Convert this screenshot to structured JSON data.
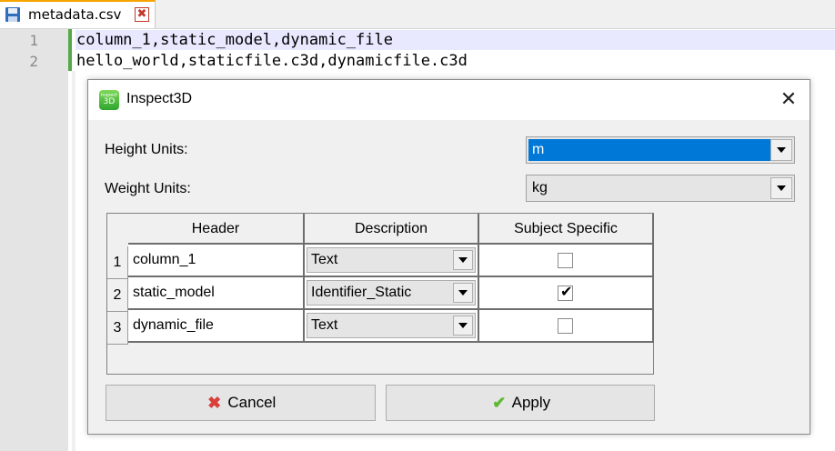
{
  "editor": {
    "tab": {
      "label": "metadata.csv",
      "close_symbol": "✖"
    },
    "lines": [
      {
        "number": "1",
        "text": "column_1,static_model,dynamic_file"
      },
      {
        "number": "2",
        "text": "hello_world,staticfile.c3d,dynamicfile.c3d"
      }
    ]
  },
  "dialog": {
    "icon_text": "3D",
    "icon_small": "inspect",
    "title": "Inspect3D",
    "close_symbol": "✕",
    "height_units": {
      "label": "Height Units:",
      "value": "m"
    },
    "weight_units": {
      "label": "Weight Units:",
      "value": "kg"
    },
    "table": {
      "headers": [
        "Header",
        "Description",
        "Subject Specific"
      ],
      "rows": [
        {
          "num": "1",
          "header": "column_1",
          "description": "Text",
          "subject_specific": false
        },
        {
          "num": "2",
          "header": "static_model",
          "description": "Identifier_Static",
          "subject_specific": true
        },
        {
          "num": "3",
          "header": "dynamic_file",
          "description": "Text",
          "subject_specific": false
        }
      ]
    },
    "buttons": {
      "cancel": {
        "label": "Cancel",
        "icon": "✖"
      },
      "apply": {
        "label": "Apply",
        "icon": "✔"
      }
    }
  },
  "colors": {
    "selection": "#0078d7",
    "fold_marker": "#56a84a",
    "tab_accent": "#f6a400"
  }
}
